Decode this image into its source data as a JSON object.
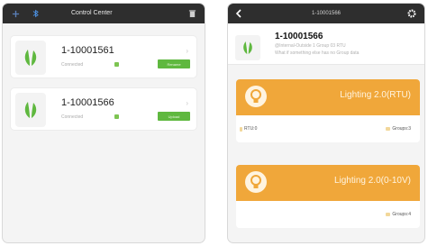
{
  "left": {
    "header": {
      "title": "Control Center"
    },
    "devices": [
      {
        "name": "1-10001561",
        "status": "Connected",
        "badge": "Rename"
      },
      {
        "name": "1-10001566",
        "status": "Connected",
        "badge": "Upload"
      }
    ]
  },
  "right": {
    "header": {
      "title": "1-10001566"
    },
    "device": {
      "name": "1-10001566",
      "desc1": "@Internal-Outside 1 Group 03 RTU",
      "desc2": "What if something else has no Group data"
    },
    "groups": [
      {
        "title": "Lighting 2.0(RTU)",
        "left_cell": "RTU:0",
        "right_cell": "Groups:3"
      },
      {
        "title": "Lighting 2.0(0-10V)",
        "left_cell": "",
        "right_cell": "Groups:4"
      }
    ]
  },
  "colors": {
    "accent_orange": "#f0a73a",
    "status_green": "#5fb83f",
    "topbar": "#2e2e2e"
  }
}
